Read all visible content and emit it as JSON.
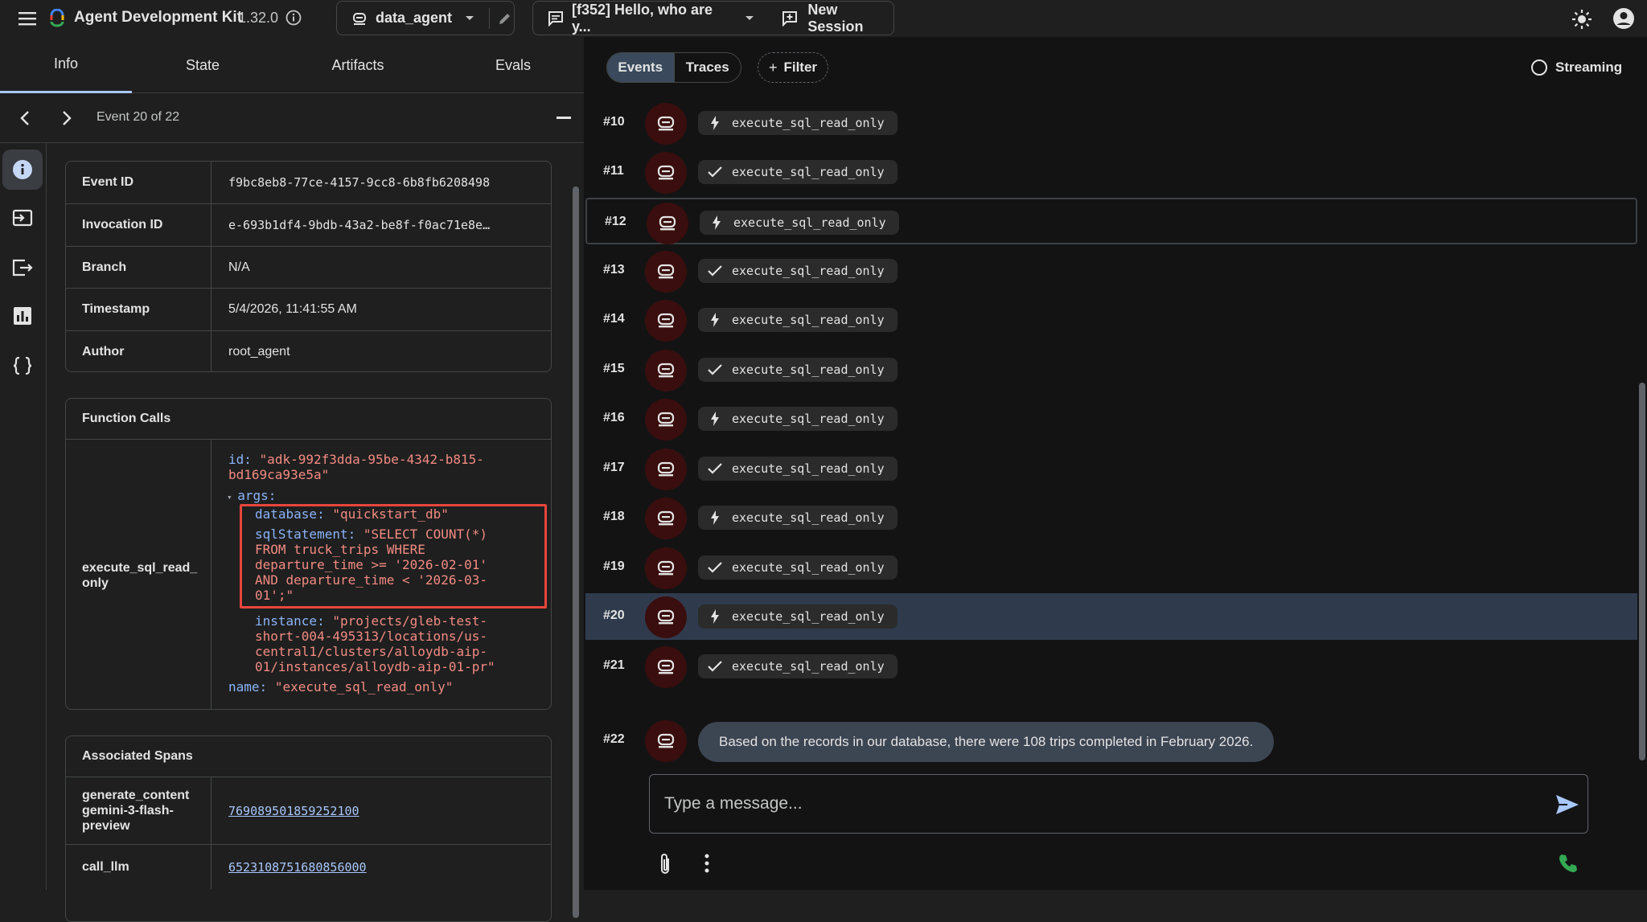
{
  "header": {
    "app_title": "Agent Development Kit",
    "version": "1.32.0",
    "agent": "data_agent",
    "session": "[f352] Hello, who are y...",
    "new_session_label": "New Session"
  },
  "tabs": [
    "Info",
    "State",
    "Artifacts",
    "Evals"
  ],
  "event_nav": {
    "label": "Event 20 of 22"
  },
  "info": {
    "rows": [
      {
        "key": "Event ID",
        "value": "f9bc8eb8-77ce-4157-9cc8-6b8fb6208498"
      },
      {
        "key": "Invocation ID",
        "value": "e-693b1df4-9bdb-43a2-be8f-f0ac71e8e…"
      },
      {
        "key": "Branch",
        "value": "N/A"
      },
      {
        "key": "Timestamp",
        "value": "5/4/2026, 11:41:55 AM"
      },
      {
        "key": "Author",
        "value": "root_agent"
      }
    ]
  },
  "function_calls": {
    "title": "Function Calls",
    "name_line1": "execute_sql_read_",
    "name_line2": "only",
    "id_key": "id:",
    "id_l1": "\"adk-992f3dda-95be-4342-b815-",
    "id_l2": "bd169ca93e5a\"",
    "args_key": "args:",
    "database_key": "database:",
    "database_val": "\"quickstart_db\"",
    "sql_key": "sqlStatement:",
    "sql_l1": "\"SELECT COUNT(*)",
    "sql_l2": "FROM truck_trips WHERE",
    "sql_l3": "departure_time >= '2026-02-01'",
    "sql_l4": "AND departure_time < '2026-03-",
    "sql_l5": "01';\"",
    "instance_key": "instance:",
    "instance_l1": "\"projects/gleb-test-",
    "instance_l2": "short-004-495313/locations/us-",
    "instance_l3": "central1/clusters/alloydb-aip-",
    "instance_l4": "01/instances/alloydb-aip-01-pr\"",
    "name_key": "name:",
    "name_val": "\"execute_sql_read_only\""
  },
  "associated_spans": {
    "title": "Associated Spans",
    "rows": [
      {
        "key_l1": "generate_content",
        "key_l2": "gemini-3-flash-",
        "key_l3": "preview",
        "value": "769089501859252100"
      },
      {
        "key_l1": "call_llm",
        "value": "6523108751680856000"
      }
    ]
  },
  "right": {
    "events_label": "Events",
    "traces_label": "Traces",
    "filter_label": "Filter",
    "streaming_label": "Streaming",
    "events": [
      {
        "num": "#10",
        "icon": "bolt-icon",
        "label": "execute_sql_read_only"
      },
      {
        "num": "#11",
        "icon": "check-icon",
        "label": "execute_sql_read_only"
      },
      {
        "num": "#12",
        "icon": "bolt-icon",
        "label": "execute_sql_read_only"
      },
      {
        "num": "#13",
        "icon": "check-icon",
        "label": "execute_sql_read_only"
      },
      {
        "num": "#14",
        "icon": "bolt-icon",
        "label": "execute_sql_read_only"
      },
      {
        "num": "#15",
        "icon": "check-icon",
        "label": "execute_sql_read_only"
      },
      {
        "num": "#16",
        "icon": "bolt-icon",
        "label": "execute_sql_read_only"
      },
      {
        "num": "#17",
        "icon": "check-icon",
        "label": "execute_sql_read_only"
      },
      {
        "num": "#18",
        "icon": "bolt-icon",
        "label": "execute_sql_read_only"
      },
      {
        "num": "#19",
        "icon": "check-icon",
        "label": "execute_sql_read_only"
      },
      {
        "num": "#20",
        "icon": "bolt-icon",
        "label": "execute_sql_read_only"
      },
      {
        "num": "#21",
        "icon": "check-icon",
        "label": "execute_sql_read_only"
      }
    ],
    "final_message": {
      "num": "#22",
      "text": "Based on the records in our database, there were 108 trips completed in February 2026."
    },
    "input_placeholder": "Type a message..."
  },
  "colors": {
    "accent": "#a8c7fa",
    "highlight_box": "#e8453c",
    "call_green": "#34a853",
    "selected_row": "#2f3b4d"
  }
}
